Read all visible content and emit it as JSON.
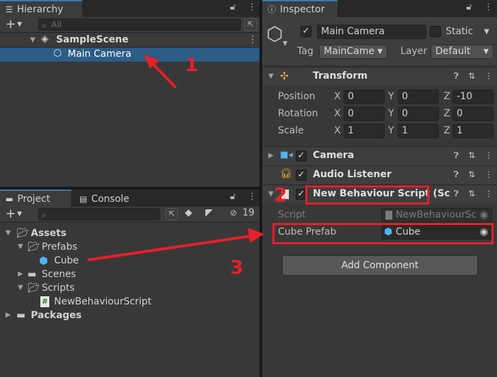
{
  "hierarchy": {
    "tab_label": "Hierarchy",
    "add_label": "+",
    "search_placeholder": "All",
    "scene_name": "SampleScene",
    "selected_item": "Main Camera"
  },
  "project": {
    "tab_project": "Project",
    "tab_console": "Console",
    "hidden_count": "19",
    "tree": [
      {
        "label": "Assets",
        "bold": true
      },
      {
        "label": "Prefabs"
      },
      {
        "label": "Cube"
      },
      {
        "label": "Scenes"
      },
      {
        "label": "Scripts"
      },
      {
        "label": "NewBehaviourScript"
      },
      {
        "label": "Packages",
        "bold": true
      }
    ]
  },
  "inspector": {
    "tab_label": "Inspector",
    "object_name": "Main Camera",
    "static_label": "Static",
    "tag_label": "Tag",
    "tag_value": "MainCame",
    "layer_label": "Layer",
    "layer_value": "Default",
    "transform": {
      "title": "Transform",
      "position_label": "Position",
      "rotation_label": "Rotation",
      "scale_label": "Scale",
      "axis_x": "X",
      "axis_y": "Y",
      "axis_z": "Z",
      "position": [
        "0",
        "0",
        "-10"
      ],
      "rotation": [
        "0",
        "0",
        "0"
      ],
      "scale": [
        "1",
        "1",
        "1"
      ]
    },
    "camera_title": "Camera",
    "audio_title": "Audio Listener",
    "script_component": {
      "title": "New Behaviour Script (Sc",
      "script_label": "Script",
      "script_value": "NewBehaviourSc",
      "cube_prefab_label": "Cube Prefab",
      "cube_prefab_value": "Cube"
    },
    "add_component_label": "Add Component"
  },
  "annotations": {
    "n1": "1",
    "n2": "2",
    "n3": "3",
    "color": "#e8202a"
  }
}
